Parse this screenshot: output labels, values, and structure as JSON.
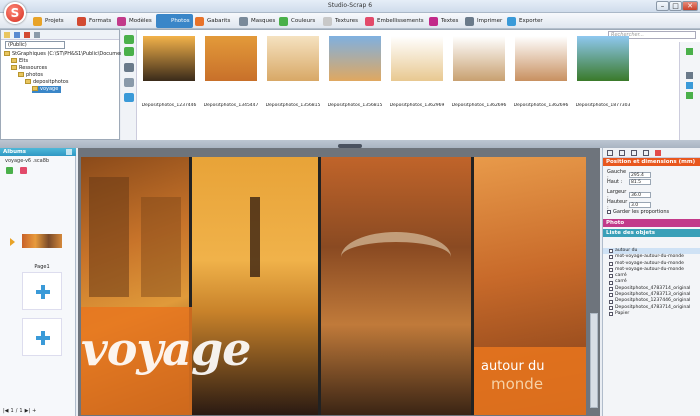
{
  "window": {
    "title": "Studio-Scrap 6",
    "logo_letter": "S"
  },
  "menu": [
    {
      "label": "Projets",
      "icon": "folder-icon",
      "color": "#e8a328"
    },
    {
      "label": "Formats",
      "icon": "formats-icon",
      "color": "#d24a32"
    },
    {
      "label": "Modèles",
      "icon": "templates-icon",
      "color": "#c23a8a"
    },
    {
      "label": "Photos",
      "icon": "photo-icon",
      "color": "#3a86c8",
      "active": true
    },
    {
      "label": "Gabarits",
      "icon": "puzzle-icon",
      "color": "#e8732a"
    },
    {
      "label": "Masques",
      "icon": "mask-icon",
      "color": "#7a8a9a"
    },
    {
      "label": "Couleurs",
      "icon": "color-wheel-icon",
      "color": "#4ab04a"
    },
    {
      "label": "Textures",
      "icon": "texture-icon",
      "color": "#c8c8c8"
    },
    {
      "label": "Embellissements",
      "icon": "embellishment-icon",
      "color": "#e24a6a"
    },
    {
      "label": "Textes",
      "icon": "text-a-icon",
      "color": "#c22a8a"
    },
    {
      "label": "Imprimer",
      "icon": "printer-icon",
      "color": "#6a7a8a"
    },
    {
      "label": "Exporter",
      "icon": "export-icon",
      "color": "#3a9ad8"
    }
  ],
  "tree": {
    "combo": "(Public)",
    "nodes": [
      "StGraphiques (C:\\ST\\PH&S1\\Public\\Documents)",
      "Elts",
      "Ressources",
      "photos",
      "depositphotos",
      "voyage"
    ]
  },
  "thumbs": {
    "search_placeholder": "Rechercher...",
    "row1": [
      {
        "caption": "Depositphotos_1237446",
        "c1": "#f3b24a",
        "c2": "#3a2a1a"
      },
      {
        "caption": "Depositphotos_1345447",
        "c1": "#e39a3a",
        "c2": "#c8702a"
      },
      {
        "caption": "Depositphotos_1356815",
        "c1": "#f5e2c0",
        "c2": "#d8a866"
      },
      {
        "caption": "Depositphotos_1356815",
        "c1": "#7fb0e0",
        "c2": "#e0a860"
      },
      {
        "caption": "Depositphotos_1362969",
        "c1": "#ffffff",
        "c2": "#e8c890"
      },
      {
        "caption": "Depositphotos_1362696",
        "c1": "#ffffff",
        "c2": "#c8a070"
      },
      {
        "caption": "Depositphotos_1362696",
        "c1": "#ffffff",
        "c2": "#c89060"
      },
      {
        "caption": "Depositphotos_1877303",
        "c1": "#8fc8f0",
        "c2": "#3a7a2a"
      }
    ]
  },
  "albums": {
    "header": "Albums",
    "album_name": "voyage-v6 .sca8b",
    "page_label": "Page1",
    "pager": [
      "1",
      "/",
      "1",
      "+"
    ]
  },
  "artwork": {
    "word_voyage": "voyage",
    "box_line1": "autour du",
    "box_line2": "monde"
  },
  "props": {
    "section1": "Position et dimensions (mm)",
    "fields": [
      {
        "label": "Gauche :",
        "value": "295.4"
      },
      {
        "label": "Haut :",
        "value": "81.5"
      },
      {
        "label": "Largeur :",
        "value": "36.0"
      },
      {
        "label": "Hauteur :",
        "value": "3.0"
      }
    ],
    "keep_ratio": "Garder les proportions",
    "section2": "Photo",
    "section3": "Liste des objets",
    "objects": [
      "autour du",
      "mot-voyage-autour-du-monde",
      "mot-voyage-autour-du-monde",
      "mot-voyage-autour-du-monde",
      "carré",
      "carré",
      "Depositphotos_4783714_original",
      "Depositphotos_4783713_original",
      "Depositphotos_1237446_original",
      "Depositphotos_4783714_original",
      "Papier"
    ]
  },
  "colors": {
    "accent": "#3a86c8",
    "albums_head": "#2f98c4",
    "props_head": "#e8571e",
    "photo_head": "#c23a8a",
    "list_head": "#3aa0b8"
  }
}
